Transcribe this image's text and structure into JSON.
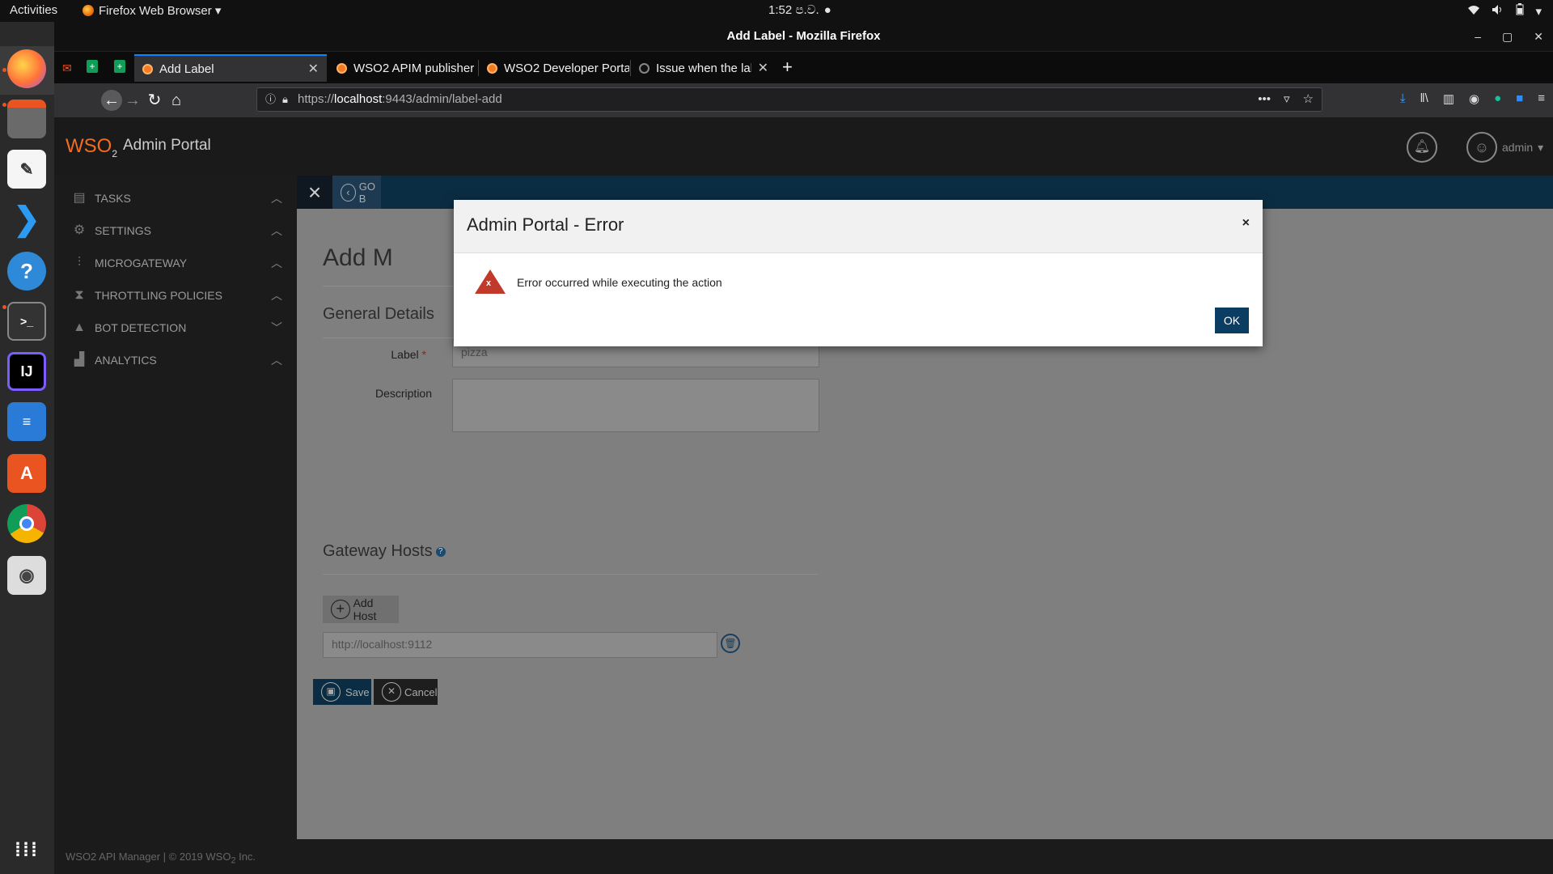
{
  "os": {
    "activities": "Activities",
    "app_menu": "Firefox Web Browser ▾",
    "clock": "1:52 ප.ව.",
    "tray": [
      "wifi-icon",
      "volume-icon",
      "battery-icon",
      "power-menu-icon"
    ]
  },
  "dock": {
    "items": [
      "firefox-icon",
      "files-icon",
      "text-editor-icon",
      "vscode-icon",
      "help-icon",
      "terminal-icon",
      "intellij-icon",
      "writer-icon",
      "software-center-icon",
      "chrome-icon",
      "screenshot-icon",
      "show-apps-icon"
    ]
  },
  "window": {
    "title": "Add Label - Mozilla Firefox"
  },
  "tabs": [
    {
      "label": "Add Label"
    },
    {
      "label": "WSO2 APIM publisher"
    },
    {
      "label": "WSO2 Developer Portal"
    },
    {
      "label": "Issue when the label leng"
    }
  ],
  "urlbar": {
    "scheme": "https://",
    "host": "localhost",
    "rest": ":9443/admin/label-add"
  },
  "app": {
    "logo": "WSO",
    "logo_sub": "2",
    "title": "Admin Portal",
    "user": "admin"
  },
  "sidebar": {
    "items": [
      {
        "label": "TASKS",
        "icon": "tasks-icon",
        "chev": "︿"
      },
      {
        "label": "SETTINGS",
        "icon": "gear-icon",
        "chev": "︿"
      },
      {
        "label": "MICROGATEWAY",
        "icon": "sliders-icon",
        "chev": "︿"
      },
      {
        "label": "THROTTLING POLICIES",
        "icon": "throttle-icon",
        "chev": "︿"
      },
      {
        "label": "BOT DETECTION",
        "icon": "warning-icon",
        "chev": "﹀"
      },
      {
        "label": "ANALYTICS",
        "icon": "analytics-icon",
        "chev": "︿"
      }
    ]
  },
  "content": {
    "back_label": "GO B",
    "page_title": "Add M",
    "general_details": "General Details",
    "label_field_label": "Label",
    "label_required": "*",
    "label_value": "pizza",
    "description_label": "Description",
    "description_value": "",
    "gateway_hosts": "Gateway Hosts",
    "add_host": "Add Host",
    "host_value": "http://localhost:9112",
    "save": "Save",
    "cancel": "Cancel"
  },
  "footer": {
    "text": "WSO2 API Manager | © 2019 WSO",
    "text_sub": "2",
    "text_end": " Inc."
  },
  "dialog": {
    "title": "Admin Portal - Error",
    "close": "×",
    "message": "Error occurred while executing the action",
    "ok": "OK"
  }
}
